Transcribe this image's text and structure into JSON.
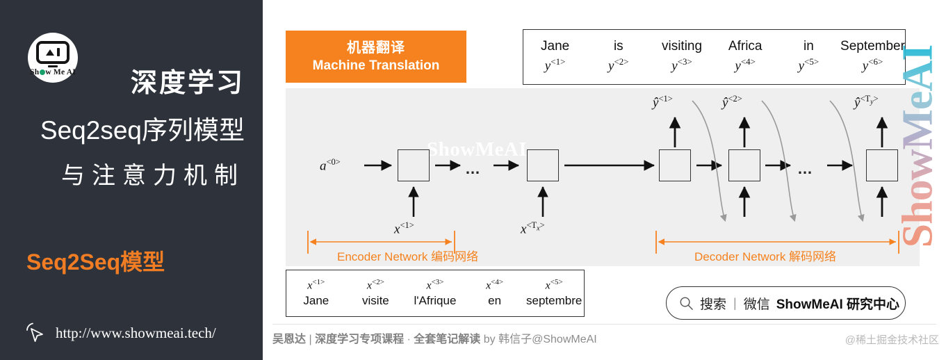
{
  "sidebar": {
    "logo": {
      "icon_name": "showmeai-logo",
      "wordmark_pre": "Sh",
      "wordmark_post": "w Me AI"
    },
    "title_line1": "深度学习",
    "title_line2": "Seq2seq序列模型",
    "title_line3": "与注意力机制",
    "subtitle": "Seq2Seq模型",
    "url": "http://www.showmeai.tech/",
    "cursor_icon": "cursor-pointer-icon",
    "bg_color": "#2e333b",
    "accent_color": "#f07d24"
  },
  "main": {
    "banner": {
      "cn": "机器翻译",
      "en": "Machine Translation",
      "bg_color": "#f5821f"
    },
    "top_sentence": {
      "words": [
        "Jane",
        "is",
        "visiting",
        "Africa",
        "in",
        "September"
      ],
      "symbols": [
        "y",
        "y",
        "y",
        "y",
        "y",
        "y"
      ],
      "superscripts": [
        "<1>",
        "<2>",
        "<3>",
        "<4>",
        "<5>",
        "<6>"
      ]
    },
    "bottom_sentence": {
      "symbols": [
        "x",
        "x",
        "x",
        "x",
        "x"
      ],
      "superscripts": [
        "<1>",
        "<2>",
        "<3>",
        "<4>",
        "<5>"
      ],
      "words": [
        "Jane",
        "visite",
        "l'Afrique",
        "en",
        "septembre"
      ]
    },
    "diagram": {
      "watermark_center": "ShowMeAI",
      "initial_state_symbol": "a",
      "initial_state_sup": "<0>",
      "encoder_inputs": [
        {
          "symbol": "x",
          "sup": "<1>"
        },
        {
          "symbol": "x",
          "sup": "<Tx>"
        }
      ],
      "decoder_outputs": [
        {
          "symbol": "ŷ",
          "sup": "<1>"
        },
        {
          "symbol": "ŷ",
          "sup": "<2>"
        },
        {
          "symbol": "ŷ",
          "sup": "<Ty>"
        }
      ],
      "ellipsis": "…",
      "encoder_range_label": "Encoder Network 编码网络",
      "decoder_range_label": "Decoder Network 解码网络",
      "range_color": "#f5821f",
      "canvas_bg": "#efefef"
    },
    "search": {
      "icon": "search-icon",
      "label_cn": "搜索",
      "divider": "|",
      "channel": "微信",
      "brand": "ShowMeAI 研究中心"
    },
    "footer": {
      "text_a": "吴恩达",
      "sep1": " | ",
      "text_b": "深度学习专项课程",
      "dot": " · ",
      "text_c": "全套笔记解读",
      "text_d": " by 韩信子@ShowMeAI",
      "corner_watermark": "@稀土掘金技术社区"
    },
    "right_watermark": "ShowMeAI"
  }
}
